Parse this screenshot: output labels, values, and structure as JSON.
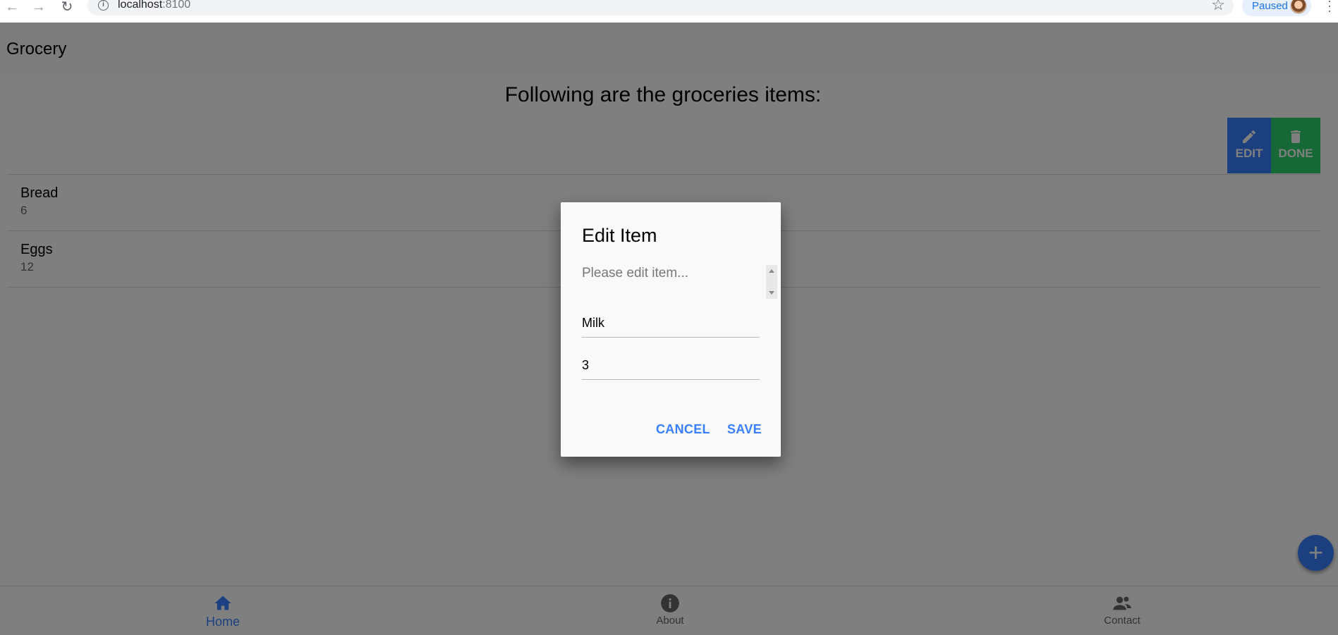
{
  "browser": {
    "url_host": "localhost",
    "url_port": ":8100",
    "profile_status": "Paused",
    "icons": [
      "back-arrow-icon",
      "forward-arrow-icon",
      "reload-icon",
      "info-icon",
      "star-icon",
      "avatar",
      "menu-dots-icon"
    ]
  },
  "header": {
    "title": "Grocery"
  },
  "main": {
    "heading": "Following are the groceries items:",
    "items": [
      {
        "name": "Bread",
        "quantity": "6"
      },
      {
        "name": "Eggs",
        "quantity": "12"
      }
    ],
    "slide_actions": {
      "edit_label": "EDIT",
      "done_label": "DONE"
    },
    "fab_icon": "add-icon"
  },
  "tabs": [
    {
      "label": "Home",
      "icon": "home-icon",
      "selected": true
    },
    {
      "label": "About",
      "icon": "info-circle-icon",
      "selected": false
    },
    {
      "label": "Contact",
      "icon": "people-icon",
      "selected": false
    }
  ],
  "dialog": {
    "title": "Edit Item",
    "message": "Please edit item...",
    "name_value": "Milk",
    "quantity_value": "3",
    "cancel_label": "CANCEL",
    "save_label": "SAVE"
  },
  "colors": {
    "primary": "#3880ff",
    "success": "#2dd36f",
    "backdrop": "rgba(0,0,0,0.5)"
  }
}
